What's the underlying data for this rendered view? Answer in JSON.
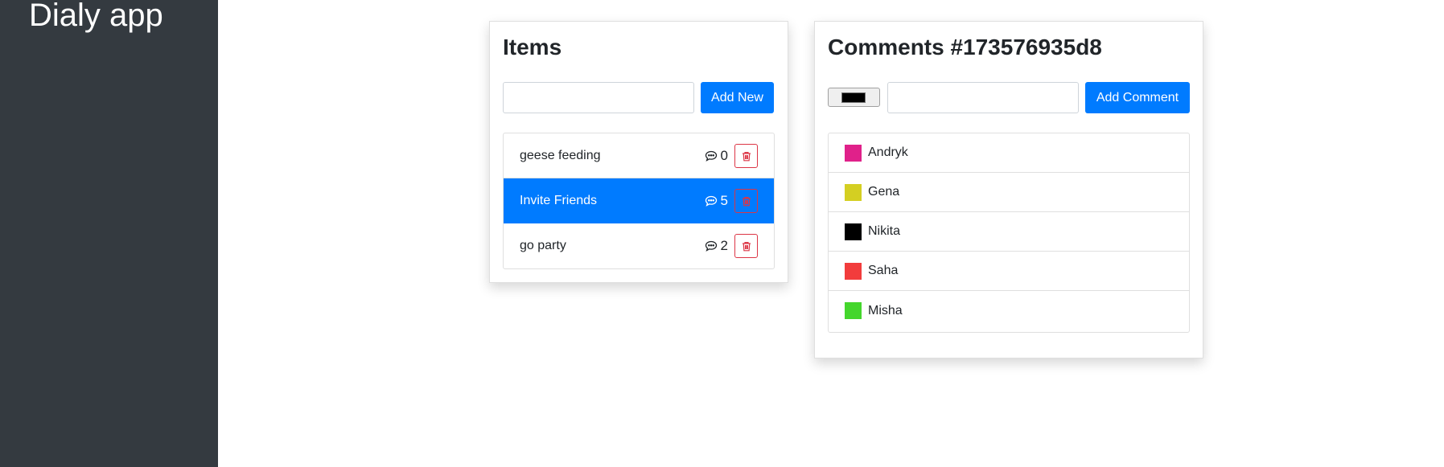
{
  "app": {
    "title": "Dialy app"
  },
  "items_panel": {
    "title": "Items",
    "input_value": "",
    "input_placeholder": "",
    "add_button": "Add New",
    "items": [
      {
        "name": "geese feeding",
        "comments": "0",
        "active": false
      },
      {
        "name": "Invite Friends",
        "comments": "5",
        "active": true
      },
      {
        "name": "go party",
        "comments": "2",
        "active": false
      }
    ]
  },
  "comments_panel": {
    "title": "Comments #173576935d8",
    "color_value": "#000000",
    "input_value": "",
    "input_placeholder": "",
    "add_button": "Add Comment",
    "comments": [
      {
        "text": "Andryk",
        "color": "#e0218a"
      },
      {
        "text": "Gena",
        "color": "#d4cf22"
      },
      {
        "text": "Nikita",
        "color": "#000000"
      },
      {
        "text": "Saha",
        "color": "#f23c3c"
      },
      {
        "text": "Misha",
        "color": "#44d62c"
      }
    ]
  },
  "colors": {
    "accent": "#007bff",
    "danger": "#dc3545",
    "sidebar": "#343a40"
  },
  "icons": {
    "comment": "speech-bubble-icon",
    "delete": "trash-icon"
  }
}
